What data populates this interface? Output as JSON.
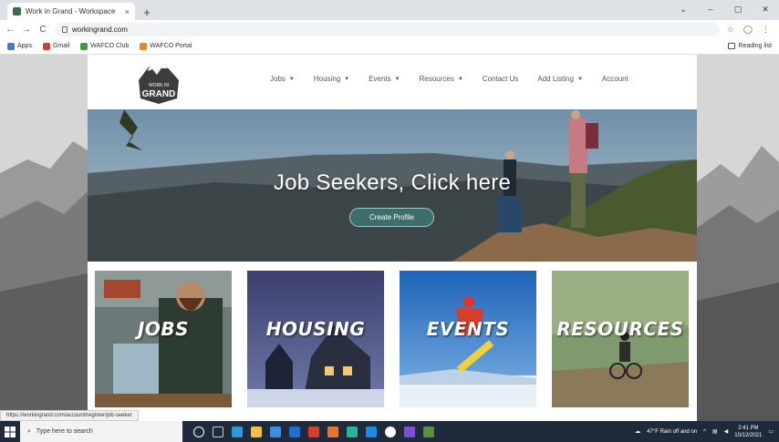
{
  "browser": {
    "tab_title": "Work in Grand - Workspace",
    "tab_close": "×",
    "new_tab": "+",
    "window_controls": [
      "⌄",
      "–",
      "▢",
      "✕"
    ],
    "url": "workingrand.com",
    "nav_back": "←",
    "nav_forward": "→",
    "nav_reload": "C",
    "right_icons": [
      "☆",
      "◯",
      "⋮"
    ],
    "bookmarks": [
      {
        "label": "Apps",
        "color": "#4a76c8"
      },
      {
        "label": "Gmail",
        "color": "#c9423a"
      },
      {
        "label": "WAFCO Club",
        "color": "#3d9a4b"
      },
      {
        "label": "WAFCO Portal",
        "color": "#e08a2a"
      }
    ],
    "reading_list": "Reading list"
  },
  "site": {
    "logo_top": "WORK IN",
    "logo_main": "GRAND",
    "nav": [
      {
        "label": "Jobs",
        "dropdown": true
      },
      {
        "label": "Housing",
        "dropdown": true
      },
      {
        "label": "Events",
        "dropdown": true
      },
      {
        "label": "Resources",
        "dropdown": true
      },
      {
        "label": "Contact Us",
        "dropdown": false
      },
      {
        "label": "Add Listing",
        "dropdown": true
      },
      {
        "label": "Account",
        "dropdown": false
      }
    ],
    "hero_title": "Job Seekers, Click here",
    "hero_button": "Create Profile",
    "cards": [
      {
        "label": "JOBS"
      },
      {
        "label": "HOUSING"
      },
      {
        "label": "EVENTS"
      },
      {
        "label": "RESOURCES"
      }
    ]
  },
  "status_url": "https://workingrand.com/account/register/job-seeker",
  "taskbar": {
    "search_placeholder": "Type here to search",
    "weather": "47°F Rain off and on",
    "time": "2:41 PM",
    "date": "10/12/2021"
  }
}
